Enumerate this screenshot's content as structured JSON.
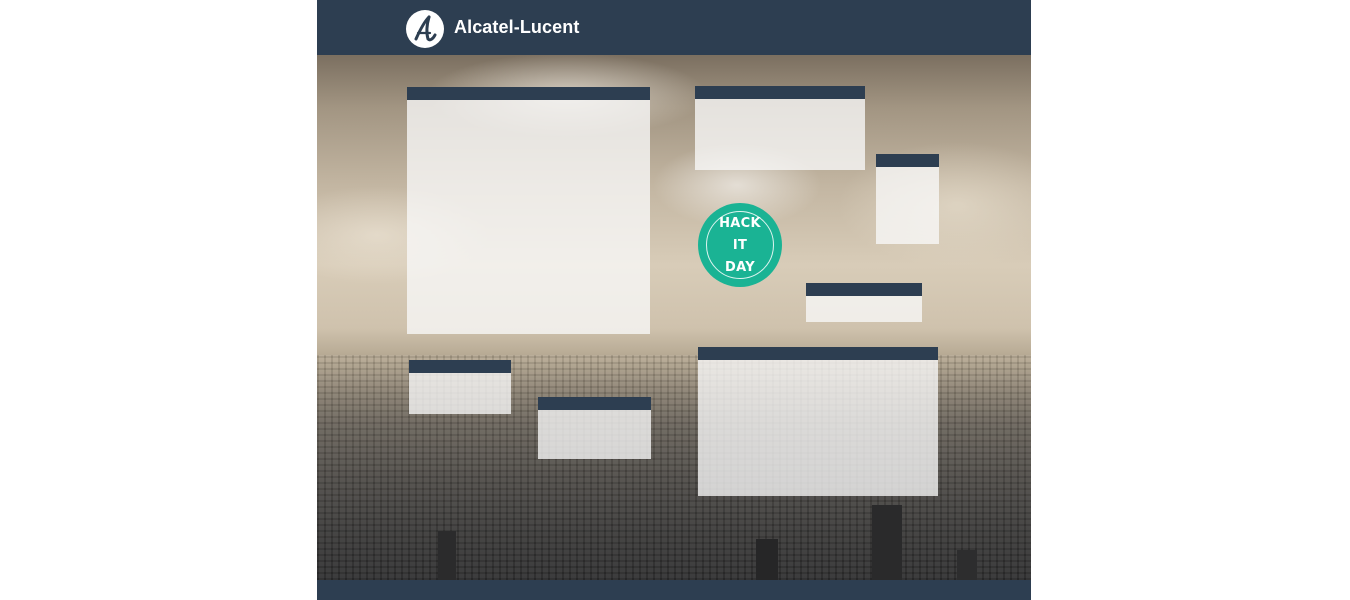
{
  "header": {
    "brand_name": "Alcatel-Lucent",
    "logo_icon": "alcatel-lucent-logo-icon"
  },
  "badge": {
    "line1": "HACK",
    "line2": "IT",
    "line3": "DAY",
    "color": "#1ab394"
  },
  "colors": {
    "header_bar": "#2d3e51",
    "panel_bar": "#2d3e51",
    "panel_body": "#f8f8f8"
  }
}
